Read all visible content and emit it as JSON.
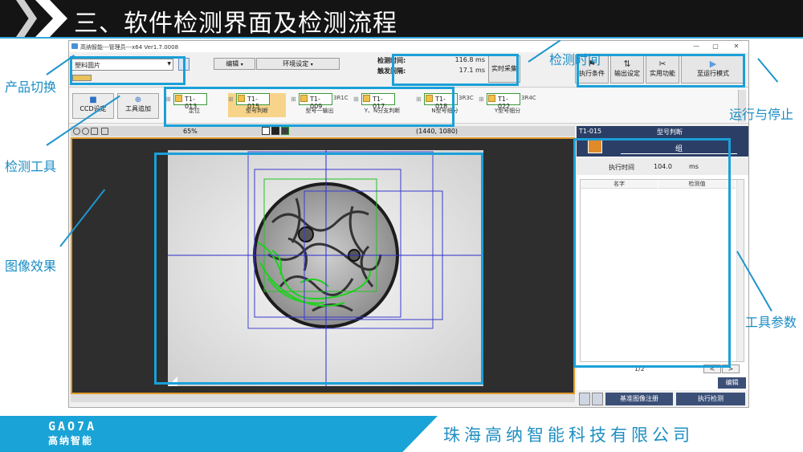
{
  "slide": {
    "title": "三、软件检测界面及检测流程",
    "footer_logo": "GAO7A",
    "footer_logo_sub": "高纳智能",
    "footer_company": "珠海高纳智能科技有限公司"
  },
  "annotations": {
    "product_switch": "产品切换",
    "detect_tools": "检测工具",
    "image_effect": "图像效果",
    "detect_time": "检测时间",
    "run_stop": "运行与停止",
    "tool_params": "工具参数"
  },
  "window": {
    "title": "高纳智能---管理员---x64 Ver1.7.0008",
    "minimize": "—",
    "maximize": "▢",
    "close": "✕"
  },
  "toolbar": {
    "product_select": "塑料圆片",
    "edit_label": "编辑",
    "env_label": "环境设定",
    "detect_time_label": "检测时间:",
    "detect_time_value": "116.8 ms",
    "trigger_label": "触发间隔:",
    "trigger_value": "17.1 ms",
    "realtime_capture": "实时采集",
    "exec_condition": "执行条件",
    "output_setting": "输出设定",
    "utility": "实用功能",
    "run_mode": "至运行模式"
  },
  "toolbar2": {
    "ccd_setting": "CCD设定",
    "tool_add": "工具追加",
    "tools": [
      {
        "id": "T1-013",
        "name": "定位",
        "ext": ""
      },
      {
        "id": "T1-015",
        "name": "型号判断",
        "ext": ""
      },
      {
        "id": "T1-009",
        "name": "型号一输出",
        "ext": "3R1C"
      },
      {
        "id": "T1-017",
        "name": "Y、N分支判断",
        "ext": ""
      },
      {
        "id": "T1-018",
        "name": "N型号细分",
        "ext": "3R3C"
      },
      {
        "id": "T1-022",
        "name": "Y型号细分",
        "ext": "3R4C"
      }
    ]
  },
  "image_view": {
    "zoom": "65%",
    "coords": "(1440, 1080)"
  },
  "right_panel": {
    "tool_id": "T1-015",
    "tool_name": "型号判断",
    "group": "组",
    "exec_time_label": "执行时间",
    "exec_time_value": "104.0",
    "exec_time_unit": "ms",
    "col_name": "名字",
    "col_value": "检测值",
    "page": "1/2",
    "prev": "<",
    "next": ">",
    "edit": "编辑"
  },
  "bottom": {
    "register_ref": "基准图像注册",
    "execute": "执行检测"
  },
  "colors": {
    "accent": "#1aa0d8",
    "panel_header": "#2b3f66",
    "selection_orange": "#e09a2c",
    "green_roi": "#22c322",
    "blue_roi": "#3a3ad0"
  }
}
